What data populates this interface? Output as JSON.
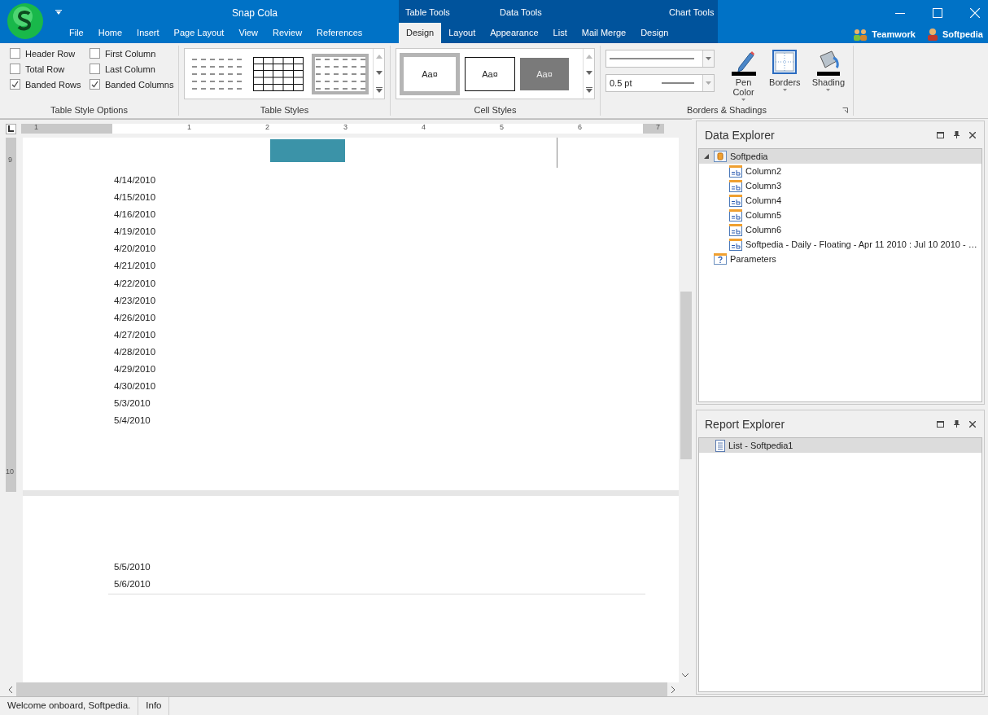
{
  "title_bar": {
    "title": "Snap Cola",
    "contextual_groups": [
      {
        "label": "Table Tools"
      },
      {
        "label": "Data Tools"
      },
      {
        "label": "Chart Tools"
      }
    ],
    "user_links": [
      {
        "label": "Teamwork",
        "kind": "team"
      },
      {
        "label": "Softpedia",
        "kind": "user"
      }
    ]
  },
  "tabs": [
    {
      "label": "File",
      "selected": false
    },
    {
      "label": "Home",
      "selected": false
    },
    {
      "label": "Insert",
      "selected": false
    },
    {
      "label": "Page Layout",
      "selected": false
    },
    {
      "label": "View",
      "selected": false
    },
    {
      "label": "Review",
      "selected": false
    },
    {
      "label": "References",
      "selected": false
    }
  ],
  "contextual_tabs": [
    {
      "label": "Design",
      "selected": true
    },
    {
      "label": "Layout",
      "selected": false
    },
    {
      "label": "Appearance",
      "selected": false
    },
    {
      "label": "List",
      "selected": false
    },
    {
      "label": "Mail Merge",
      "selected": false
    },
    {
      "label": "Design",
      "selected": false
    }
  ],
  "table_style_options": {
    "label": "Table Style Options",
    "options": [
      {
        "label": "Header Row",
        "checked": false
      },
      {
        "label": "First Column",
        "checked": false
      },
      {
        "label": "Total Row",
        "checked": false
      },
      {
        "label": "Last Column",
        "checked": false
      },
      {
        "label": "Banded Rows",
        "checked": true
      },
      {
        "label": "Banded Columns",
        "checked": true
      }
    ]
  },
  "table_styles": {
    "label": "Table Styles",
    "items": [
      {
        "kind": "plain",
        "selected": false
      },
      {
        "kind": "grid",
        "selected": false
      },
      {
        "kind": "plain",
        "selected": true
      }
    ]
  },
  "cell_styles": {
    "label": "Cell Styles",
    "items": [
      {
        "kind": "plain",
        "text": "Aa¤",
        "selected": true
      },
      {
        "kind": "outline",
        "text": "Aa¤",
        "selected": false
      },
      {
        "kind": "filled",
        "text": "Aa¤",
        "selected": false
      }
    ]
  },
  "borders_shadings": {
    "label": "Borders & Shadings",
    "line_weight": "0.5 pt",
    "buttons": [
      {
        "label": "Pen Color",
        "kind": "pen"
      },
      {
        "label": "Borders",
        "kind": "borders"
      },
      {
        "label": "Shading",
        "kind": "shading"
      }
    ]
  },
  "ruler": {
    "labels": [
      "1",
      "1",
      "2",
      "3",
      "4",
      "5",
      "6",
      "7"
    ],
    "vertical_labels": [
      "9",
      "10"
    ]
  },
  "pages": [
    {
      "dates": [
        "4/14/2010",
        "4/15/2010",
        "4/16/2010",
        "4/19/2010",
        "4/20/2010",
        "4/21/2010",
        "4/22/2010",
        "4/23/2010",
        "4/26/2010",
        "4/27/2010",
        "4/28/2010",
        "4/29/2010",
        "4/30/2010",
        "5/3/2010",
        "5/4/2010"
      ]
    },
    {
      "dates": [
        "5/5/2010",
        "5/6/2010"
      ]
    }
  ],
  "data_explorer": {
    "title": "Data Explorer",
    "tree": [
      {
        "label": "Softpedia",
        "kind": "datasource",
        "expanded": true,
        "selected": true,
        "children": [
          {
            "label": "Column2",
            "kind": "field",
            "selected": false
          },
          {
            "label": "Column3",
            "kind": "field",
            "selected": false
          },
          {
            "label": "Column4",
            "kind": "field",
            "selected": false
          },
          {
            "label": "Column5",
            "kind": "field",
            "selected": false
          },
          {
            "label": "Column6",
            "kind": "field",
            "selected": false
          },
          {
            "label": "Softpedia - Daily - Floating - Apr 11 2010 : Jul 10 2010 - …",
            "kind": "field",
            "selected": false
          }
        ]
      },
      {
        "label": "Parameters",
        "kind": "parameters",
        "selected": false
      }
    ]
  },
  "report_explorer": {
    "title": "Report Explorer",
    "items": [
      {
        "label": "List - Softpedia1",
        "selected": true
      }
    ]
  },
  "status_bar": [
    "Welcome onboard, Softpedia.",
    "Info"
  ]
}
